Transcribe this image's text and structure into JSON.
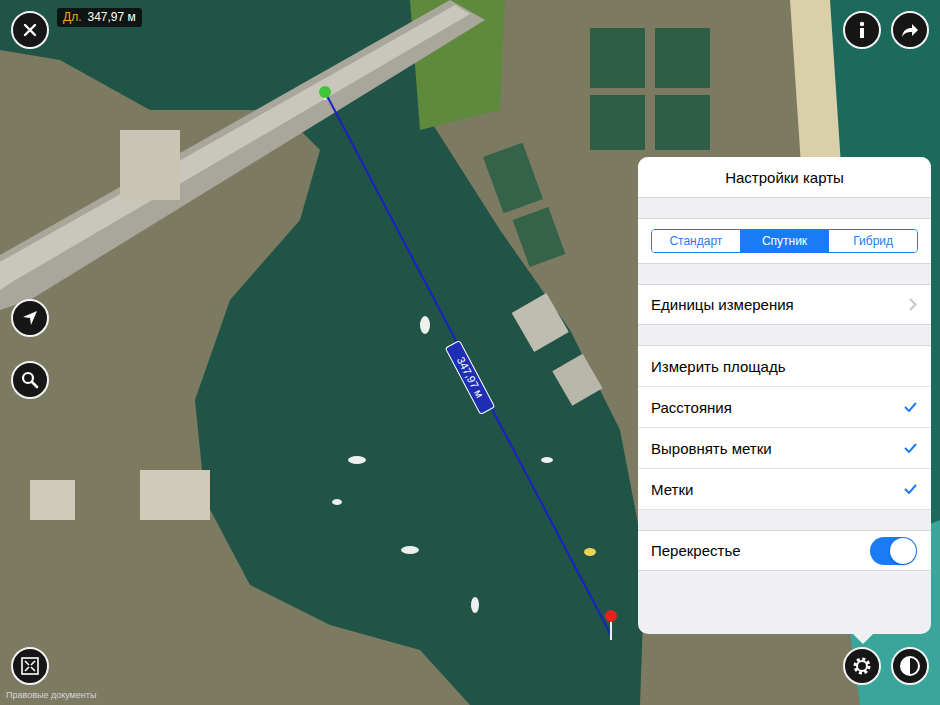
{
  "readout": {
    "prefix": "Дл.",
    "value": "347,97 м"
  },
  "line_label": "347,97 м",
  "pins": [
    {
      "name": "start",
      "color": "#3fc43a"
    },
    {
      "name": "end",
      "color": "#e3221c"
    }
  ],
  "legal": "Правовые документы",
  "settings": {
    "title": "Настройки карты",
    "map_types": [
      {
        "label": "Стандарт",
        "selected": false
      },
      {
        "label": "Спутник",
        "selected": true
      },
      {
        "label": "Гибрид",
        "selected": false
      }
    ],
    "units": {
      "label": "Единицы измерения"
    },
    "options": [
      {
        "label": "Измерить площадь",
        "checked": false
      },
      {
        "label": "Расстояния",
        "checked": true
      },
      {
        "label": "Выровнять метки",
        "checked": true
      },
      {
        "label": "Метки",
        "checked": true
      }
    ],
    "crosshair": {
      "label": "Перекрестье",
      "on": true
    }
  }
}
